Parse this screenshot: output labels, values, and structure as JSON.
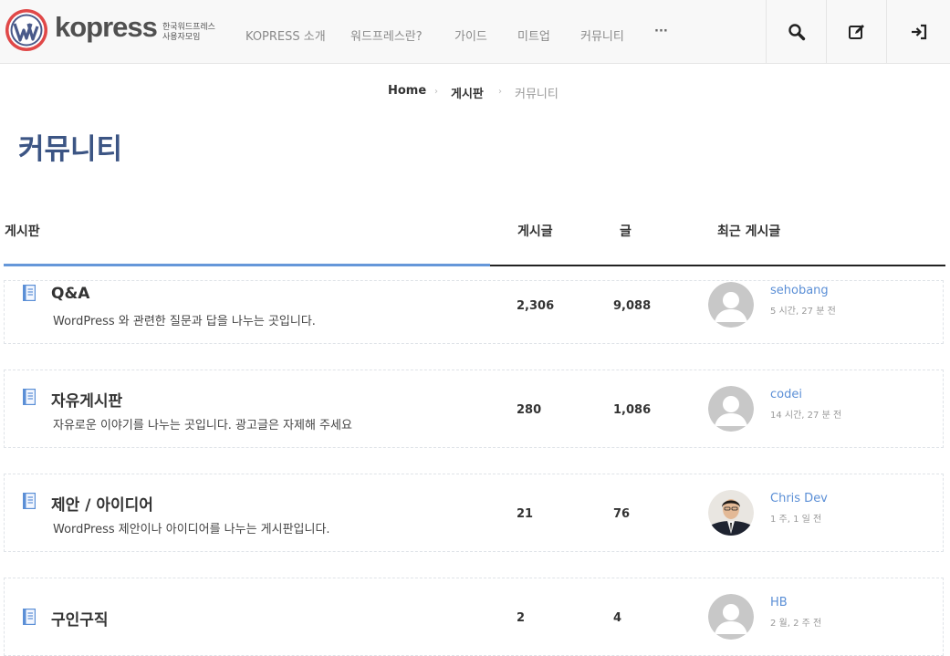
{
  "brand": {
    "name": "kopress",
    "tagline_line1": "한국워드프레스",
    "tagline_line2": "사용자모임"
  },
  "nav": {
    "items": [
      "KOPRESS 소개",
      "워드프레스란?",
      "가이드",
      "미트업",
      "커뮤니티"
    ],
    "more": "···"
  },
  "header_icons": [
    "search-icon",
    "edit-icon",
    "login-icon"
  ],
  "breadcrumb": {
    "home": "Home",
    "board": "게시판",
    "current": "커뮤니티",
    "separator": "›"
  },
  "page_title": "커뮤니티",
  "table": {
    "headers": {
      "board": "게시판",
      "topics": "게시글",
      "posts": "글",
      "recent": "최근 게시글"
    },
    "rows": [
      {
        "title": "Q&A",
        "description": "WordPress 와 관련한 질문과 답을 나누는 곳입니다.",
        "topics": "2,306",
        "posts": "9,088",
        "author": "sehobang",
        "ago": "5 시간, 27 분 전",
        "avatar": "default"
      },
      {
        "title": "자유게시판",
        "description": "자유로운 이야기를 나누는 곳입니다. 광고글은 자제해 주세요",
        "topics": "280",
        "posts": "1,086",
        "author": "codei",
        "ago": "14 시간, 27 분 전",
        "avatar": "default"
      },
      {
        "title": "제안 / 아이디어",
        "description": "WordPress 제안이나 아이디어를 나누는 게시판입니다.",
        "topics": "21",
        "posts": "76",
        "author": "Chris Dev",
        "ago": "1 주, 1 일 전",
        "avatar": "photo"
      },
      {
        "title": "구인구직",
        "description": "",
        "topics": "2",
        "posts": "4",
        "author": "HB",
        "ago": "2 월, 2 주 전",
        "avatar": "default"
      }
    ]
  },
  "colors": {
    "title": "#3c5584",
    "link": "#5b8fd6",
    "accent_rule": "#6597d9",
    "header_bg": "#f8f8f8"
  }
}
